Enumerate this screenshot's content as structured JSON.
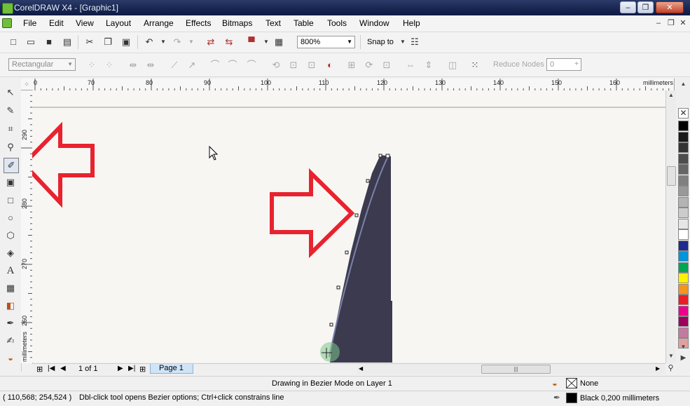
{
  "window": {
    "title": "CorelDRAW X4 - [Graphic1]",
    "controls": {
      "minimize": "–",
      "restore": "❐",
      "close": "✕"
    }
  },
  "menu": {
    "items": [
      "File",
      "Edit",
      "View",
      "Layout",
      "Arrange",
      "Effects",
      "Bitmaps",
      "Text",
      "Table",
      "Tools",
      "Window",
      "Help"
    ]
  },
  "toolbar": {
    "zoom_value": "800%",
    "snap_to_label": "Snap to"
  },
  "property_bar": {
    "node_type_value": "Rectangular",
    "reduce_nodes_label": "Reduce Nodes",
    "reduce_nodes_value": "0"
  },
  "rulers": {
    "horizontal_ticks": [
      "0",
      "70",
      "80",
      "90",
      "100",
      "110",
      "120",
      "130",
      "140",
      "150",
      "160"
    ],
    "horizontal_unit": "millimeters",
    "vertical_ticks": [
      "290",
      "280",
      "270",
      "260"
    ],
    "vertical_unit": "millimeters"
  },
  "page_nav": {
    "counter": "1 of 1",
    "page_tab": "Page 1"
  },
  "status": {
    "mode_text": "Drawing in Bezier Mode on Layer 1",
    "coordinates": "( 110,568; 254,524 )",
    "hint": "Dbl-click tool opens Bezier options; Ctrl+click constrains line",
    "fill_label": "None",
    "outline_label": "Black  0,200 millimeters"
  },
  "colors": {
    "annotation_arrow": "#e8232f",
    "shape_fill": "#3b3a4e",
    "palette": [
      "#000000",
      "#1a1a1a",
      "#333333",
      "#4d4d4d",
      "#666666",
      "#808080",
      "#999999",
      "#b3b3b3",
      "#cccccc",
      "#e6e6e6",
      "#ffffff",
      "#1f2a8f",
      "#0095d9",
      "#00a651",
      "#fff200",
      "#f7941d",
      "#ed1c24",
      "#ec008c",
      "#9e005d",
      "#c27ba0",
      "#e0a0a0"
    ]
  }
}
